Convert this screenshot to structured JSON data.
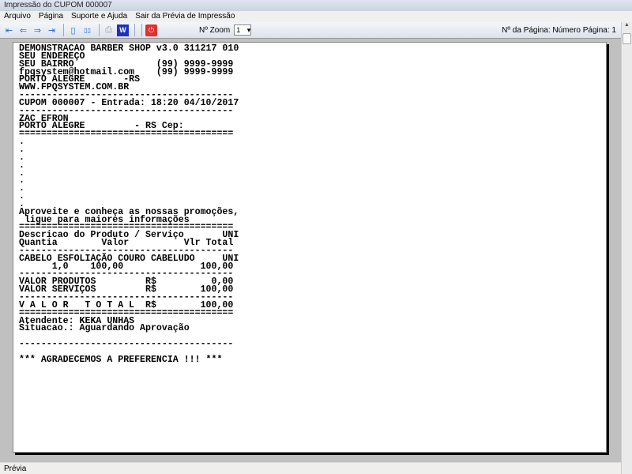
{
  "window": {
    "title": "Impressão do CUPOM 000007"
  },
  "menu": [
    "Arquivo",
    "Página",
    "Suporte e Ajuda",
    "Sair da Prévia de Impressão"
  ],
  "toolbar": {
    "first": "⇤",
    "prev": "⇐",
    "next": "⇒",
    "last": "⇥",
    "single_page": "▯",
    "two_pages": "▯▯",
    "print": "⎙",
    "word": "W",
    "exit": "⏻",
    "zoom_label": "Nº Zoom",
    "zoom_value": "1",
    "page_label": "Nº da Página: Número Página: 1"
  },
  "receipt_lines": [
    "DEMONSTRACAO BARBER SHOP v3.0 311217 010",
    "SEU ENDEREÇO",
    "SEU BAIRRO               (99) 9999-9999",
    "fpqsystem@hotmail.com    (99) 9999-9999",
    "PORTO ALEGRE       -RS",
    "WWW.FPQSYSTEM.COM.BR",
    "---------------------------------------",
    "CUPOM 000007 - Entrada: 18:20 04/10/2017",
    "---------------------------------------",
    "ZAC EFRON",
    "PORTO ALEGRE         - RS Cep:",
    "=======================================",
    ".",
    ".",
    ".",
    ".",
    ".",
    ".",
    ".",
    ".",
    ".",
    "Aproveite e conheça as nossas promoções,",
    " ligue para maiores informações",
    "=======================================",
    "Descricao do Produto / Serviço       UNI",
    "Quantia        Valor          Vlr Total",
    "---------------------------------------",
    "CABELO ESFOLIAÇÃO COURO CABELUDO     UNI",
    "      1,0    100,00              100,00",
    "---------------------------------------",
    "VALOR PRODUTOS         R$          0,00",
    "VALOR SERVIÇOS         R$        100,00",
    "---------------------------------------",
    "V A L O R   T O T A L  R$        100,00",
    "=======================================",
    "Atendente: KEKA UNHAS",
    "Situacao.: Aguardando Aprovação",
    "",
    "---------------------------------------",
    "",
    "*** AGRADECEMOS A PREFERENCIA !!! ***"
  ],
  "status": {
    "text": "Prévia"
  }
}
